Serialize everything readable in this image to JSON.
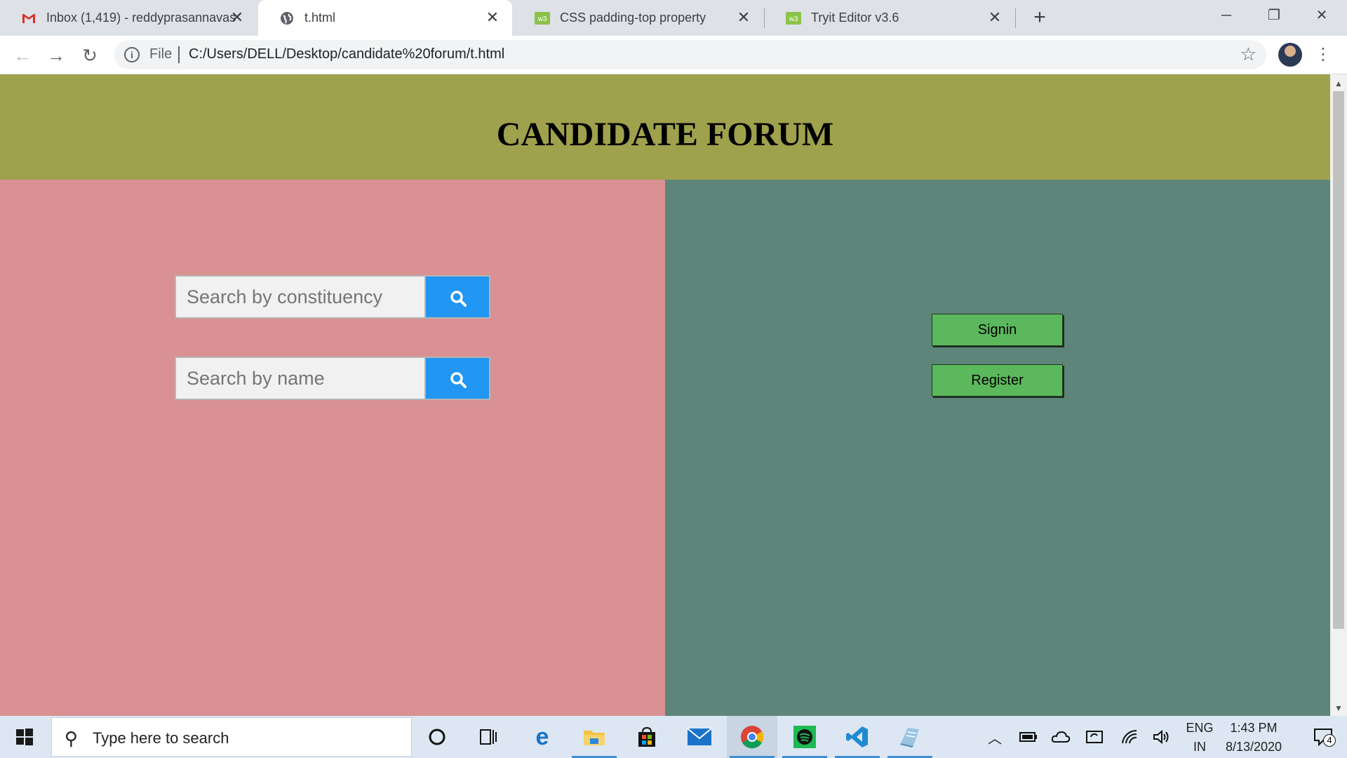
{
  "browser": {
    "tabs": [
      {
        "title": "Inbox (1,419) - reddyprasannavas",
        "icon": "gmail-icon",
        "active": false
      },
      {
        "title": "t.html",
        "icon": "globe-icon",
        "active": true
      },
      {
        "title": "CSS padding-top property",
        "icon": "w3schools-icon",
        "active": false
      },
      {
        "title": "Tryit Editor v3.6",
        "icon": "w3schools-icon",
        "active": false
      }
    ],
    "address": {
      "scheme_label": "File",
      "url": "C:/Users/DELL/Desktop/candidate%20forum/t.html"
    }
  },
  "page": {
    "title": "CANDIDATE FORUM",
    "search_constituency": {
      "placeholder": "Search by constituency",
      "value": ""
    },
    "search_name": {
      "placeholder": "Search by name",
      "value": ""
    },
    "signin_label": "Signin",
    "register_label": "Register",
    "colors": {
      "header": "#9fa14d",
      "left_panel": "#d99193",
      "right_panel": "#5e8579",
      "search_button": "#2196f3",
      "action_button": "#5cb85c"
    }
  },
  "taskbar": {
    "search_placeholder": "Type here to search",
    "apps": [
      "cortana-icon",
      "task-view-icon",
      "edge-icon",
      "file-explorer-icon",
      "store-icon",
      "mail-icon",
      "chrome-icon",
      "spotify-icon",
      "vscode-icon",
      "notepad-icon"
    ],
    "language_top": "ENG",
    "language_bottom": "IN",
    "time": "1:43 PM",
    "date": "8/13/2020",
    "notification_count": "4"
  }
}
